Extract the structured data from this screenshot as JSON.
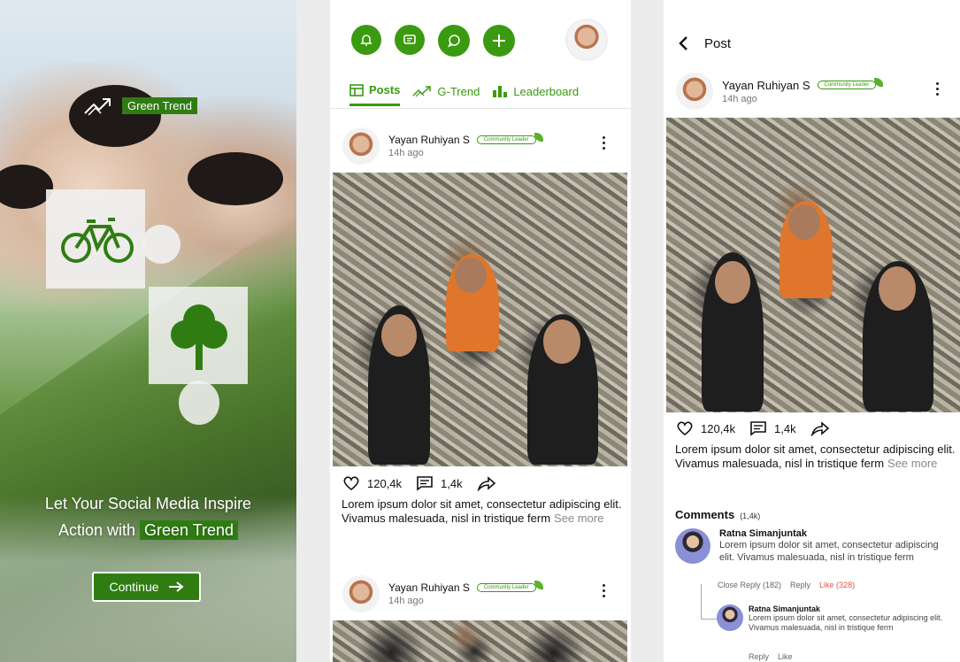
{
  "onboarding": {
    "badge": "Green Trend",
    "headline_line1": "Let Your Social Media Inspire",
    "headline_line2_prefix": "Action with",
    "headline_highlight": "Green Trend",
    "continue_label": "Continue"
  },
  "feed": {
    "tabs": [
      {
        "label": "Posts",
        "active": true
      },
      {
        "label": "G-Trend",
        "active": false
      },
      {
        "label": "Leaderboard",
        "active": false
      }
    ],
    "posts": [
      {
        "author": "Yayan Ruhiyan S",
        "badge": "Community Leader",
        "time": "14h ago",
        "likes": "120,4k",
        "comments": "1,4k",
        "caption": "Lorem ipsum dolor sit amet, consectetur adipiscing elit. Vivamus malesuada, nisl in tristique ferm",
        "see_more": "See more"
      },
      {
        "author": "Yayan Ruhiyan S",
        "badge": "Community Leader",
        "time": "14h ago"
      }
    ]
  },
  "detail": {
    "title": "Post",
    "author": "Yayan Ruhiyan S",
    "badge": "Community Leader",
    "time": "14h ago",
    "likes": "120,4k",
    "comments": "1,4k",
    "caption": "Lorem ipsum dolor sit amet, consectetur adipiscing elit. Vivamus malesuada, nisl in tristique ferm",
    "see_more": "See more",
    "comments_title": "Comments",
    "comments_count": "(1,4k)",
    "comment": {
      "name": "Ratna Simanjuntak",
      "text": "Lorem ipsum dolor sit amet, consectetur adipiscing elit. Vivamus malesuada, nisl in tristique ferm",
      "close_reply": "Close Reply (182)",
      "reply": "Reply",
      "like": "Like (328)"
    },
    "reply": {
      "name": "Ratna Simanjuntak",
      "text": "Lorem ipsum dolor sit amet, consectetur adipiscing elit. Vivamus malesuada, nisl in tristique ferm",
      "reply": "Reply",
      "like": "Like"
    }
  },
  "colors": {
    "brand_green": "#3a9a10",
    "dark_green": "#2f7d12",
    "like_red": "#e0544a"
  },
  "icons": [
    "bell-icon",
    "message-icon",
    "chat-icon",
    "plus-icon",
    "posts-icon",
    "trend-icon",
    "leaderboard-icon",
    "heart-icon",
    "comment-icon",
    "share-icon",
    "back-icon",
    "bicycle-icon",
    "tree-icon",
    "arrow-right-icon"
  ]
}
